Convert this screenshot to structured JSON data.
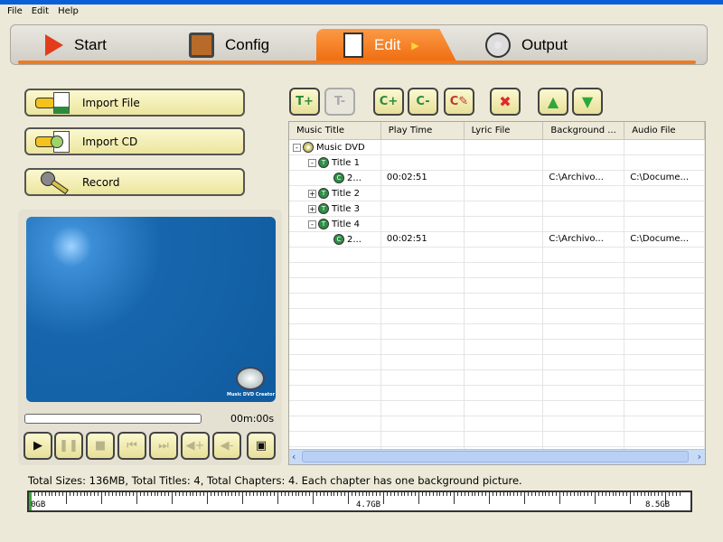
{
  "menu": [
    "File",
    "Edit",
    "Help"
  ],
  "tabs": [
    {
      "label": "Start",
      "icon": "play-triangle-icon"
    },
    {
      "label": "Config",
      "icon": "config-gear-icon"
    },
    {
      "label": "Edit",
      "icon": "edit-pencil-icon",
      "active": true
    },
    {
      "label": "Output",
      "icon": "disc-output-icon"
    }
  ],
  "actions": [
    {
      "label": "Import File",
      "icon": "import-file-icon"
    },
    {
      "label": "Import CD",
      "icon": "import-cd-icon"
    },
    {
      "label": "Record",
      "icon": "microphone-icon"
    }
  ],
  "preview": {
    "logo_text": "Music DVD Creator",
    "time": "00m:00s",
    "progress": 0
  },
  "controls": [
    "play",
    "pause",
    "stop",
    "previous",
    "next",
    "volume-up",
    "volume-down",
    "fullscreen"
  ],
  "toolbar": [
    "add-title",
    "remove-title",
    "add-chapter",
    "remove-chapter",
    "edit-chapter",
    "delete-all",
    "move-up",
    "move-down"
  ],
  "table": {
    "columns": [
      "Music Title",
      "Play Time",
      "Lyric File",
      "Background ...",
      "Audio File"
    ],
    "rows": [
      {
        "level": 0,
        "toggle": "-",
        "type": "disc",
        "title": "Music DVD",
        "time": "",
        "lyric": "",
        "bg": "",
        "audio": ""
      },
      {
        "level": 1,
        "toggle": "-",
        "type": "T",
        "title": "Title 1",
        "time": "",
        "lyric": "",
        "bg": "",
        "audio": ""
      },
      {
        "level": 2,
        "toggle": "",
        "type": "C",
        "title": "2...",
        "time": "00:02:51",
        "lyric": "",
        "bg": "C:\\Archivo...",
        "audio": "C:\\Docume..."
      },
      {
        "level": 1,
        "toggle": "+",
        "type": "T",
        "title": "Title 2",
        "time": "",
        "lyric": "",
        "bg": "",
        "audio": ""
      },
      {
        "level": 1,
        "toggle": "+",
        "type": "T",
        "title": "Title 3",
        "time": "",
        "lyric": "",
        "bg": "",
        "audio": ""
      },
      {
        "level": 1,
        "toggle": "-",
        "type": "T",
        "title": "Title 4",
        "time": "",
        "lyric": "",
        "bg": "",
        "audio": ""
      },
      {
        "level": 2,
        "toggle": "",
        "type": "C",
        "title": "2...",
        "time": "00:02:51",
        "lyric": "",
        "bg": "C:\\Archivo...",
        "audio": "C:\\Docume..."
      }
    ]
  },
  "status": "Total Sizes: 136MB, Total Titles: 4, Total Chapters: 4. Each chapter has one background picture.",
  "capacity": {
    "labels": [
      "0GB",
      "4.7GB",
      "8.5GB"
    ],
    "used_mb": 136,
    "accent": "#3aa83a"
  },
  "colors": {
    "accent": "#f07a20",
    "button": "#f4efb5"
  }
}
